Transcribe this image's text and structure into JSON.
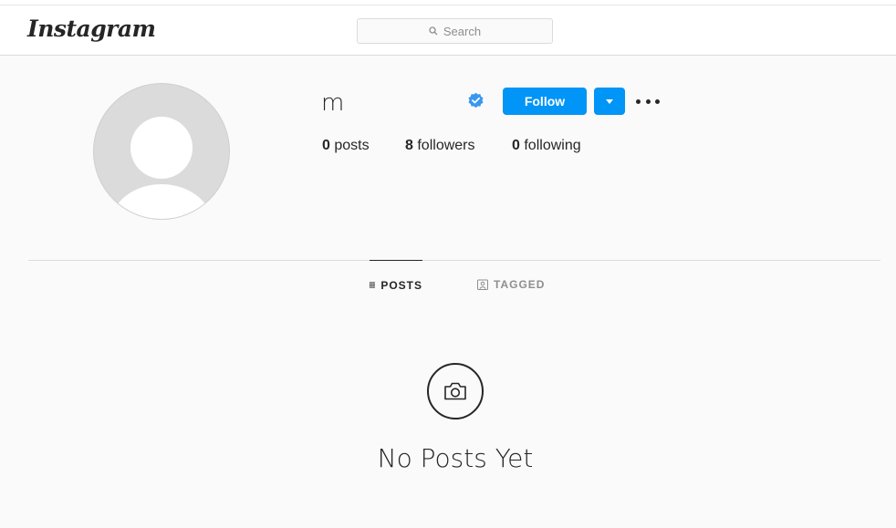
{
  "navbar": {
    "logo": "Instagram",
    "search_placeholder": "Search"
  },
  "profile": {
    "username": "m",
    "verified": true,
    "follow_label": "Follow",
    "stats": {
      "posts_count": "0",
      "posts_label": "posts",
      "followers_count": "8",
      "followers_label": "followers",
      "following_count": "0",
      "following_label": "following"
    }
  },
  "tabs": [
    {
      "label": "POSTS",
      "icon": "grid-icon",
      "active": true
    },
    {
      "label": "TAGGED",
      "icon": "tagged-icon",
      "active": false
    }
  ],
  "empty_state": {
    "icon": "camera-icon",
    "text": "No Posts Yet"
  },
  "colors": {
    "accent": "#0095f6",
    "verified": "#3897f0",
    "background": "#fafafa"
  }
}
